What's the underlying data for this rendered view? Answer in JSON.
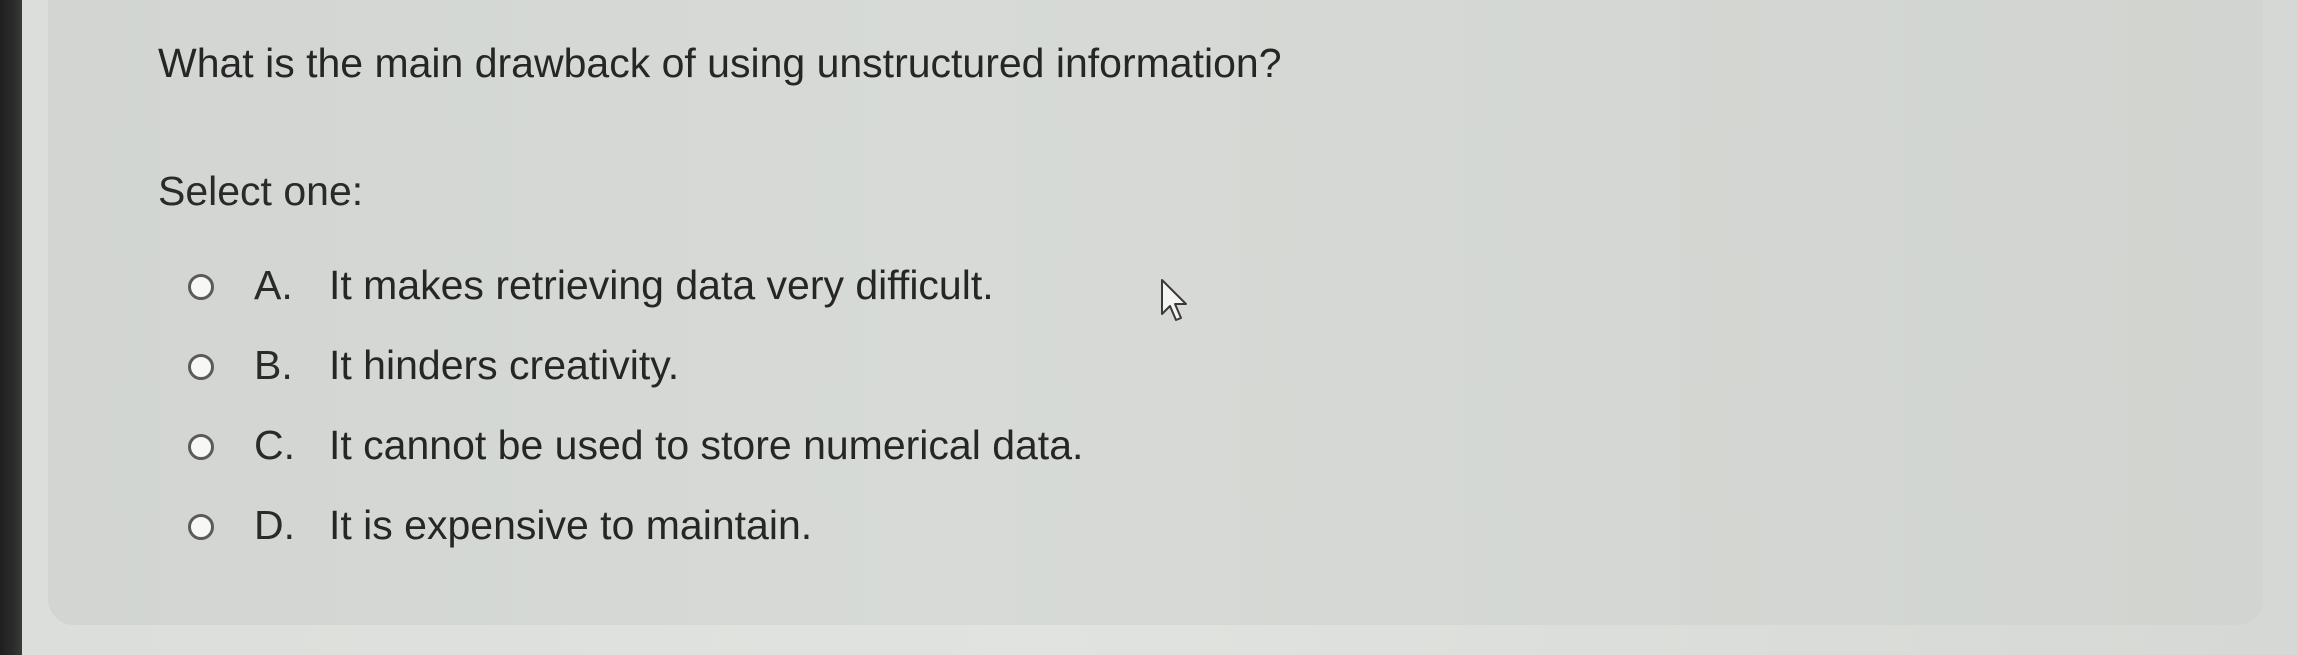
{
  "question": {
    "text": "What is the main drawback of using unstructured information?",
    "prompt": "Select one:"
  },
  "options": [
    {
      "letter": "A.",
      "text": "It makes retrieving data very difficult.",
      "selected": false
    },
    {
      "letter": "B.",
      "text": "It hinders creativity.",
      "selected": false
    },
    {
      "letter": "C.",
      "text": "It cannot be used to store numerical data.",
      "selected": false
    },
    {
      "letter": "D.",
      "text": "It is expensive to maintain.",
      "selected": false
    }
  ],
  "icons": {
    "radio": "radio-button-icon",
    "cursor": "mouse-pointer-icon"
  },
  "colors": {
    "card_background": "#d5d8d4",
    "text": "#262626",
    "radio_border": "#5a5a5a",
    "radio_fill": "#f7f7f5"
  }
}
